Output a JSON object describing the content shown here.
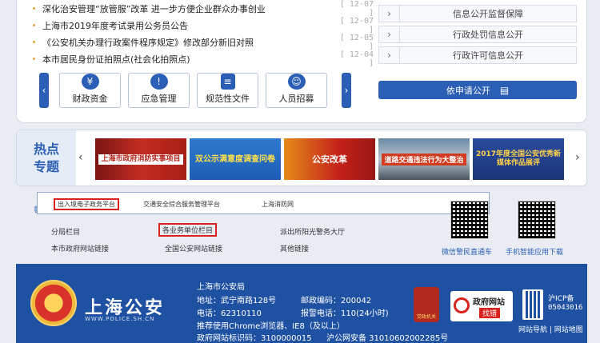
{
  "news": [
    {
      "title": "深化治安管理“放管服”改革 进一步方便企业群众办事创业",
      "date": "[ 12-07 ]"
    },
    {
      "title": "上海市2019年度考试录用公务员公告",
      "date": "[ 12-07 ]"
    },
    {
      "title": "《公安机关办理行政案件程序规定》修改部分新旧对照",
      "date": "[ 12-05 ]"
    },
    {
      "title": "本市居民身份证拍照点(社会化拍照点)",
      "date": "[ 12-04 ]"
    }
  ],
  "categories": [
    {
      "label": "财政资金",
      "icon": "¥"
    },
    {
      "label": "应急管理",
      "icon": "!"
    },
    {
      "label": "规范性文件",
      "icon": "≡"
    },
    {
      "label": "人员招募",
      "icon": "☺"
    }
  ],
  "info_public": [
    {
      "label": "信息公开监督保障"
    },
    {
      "label": "行政处罚信息公开"
    },
    {
      "label": "行政许可信息公开"
    }
  ],
  "apply_label": "依申请公开",
  "hot": {
    "label_line1": "热点",
    "label_line2": "专题",
    "banners": [
      "上海市政府消防实事项目",
      "双公示满意度调查问卷",
      "公安改革",
      "道路交通违法行为大整治",
      "2017年度全国公安优秀新媒体作品展评"
    ]
  },
  "link_tabs": [
    "出入境电子政务平台",
    "交通安全综合服务管理平台",
    "上海消防网"
  ],
  "links": {
    "branch": "分局栏目",
    "units": "各业务单位栏目",
    "station": "派出所阳光警务大厅",
    "city_gov": "本市政府网站链接",
    "national": "全国公安网站链接",
    "other": "其他链接"
  },
  "qr": {
    "wechat": "微信警民直通车",
    "app": "手机智能应用下载"
  },
  "footer": {
    "logo_cn": "上海公安",
    "logo_en": "WWW.POLICE.SH.CN",
    "org": "上海市公安局",
    "address": "地址：武宁南路128号",
    "postcode": "邮政编码：200042",
    "phone": "电话：62310110",
    "alarm": "报警电话：110(24小时)",
    "browser": "推荐使用Chrome浏览器、IE8（及以上）",
    "gov_code": "政府网站标识码：3100000015",
    "security_record": "沪公网安备 31010602002285号",
    "find_error_1": "政府网站",
    "find_error_2": "找错",
    "badge_text": "党政机关",
    "icp_1": "沪ICP备",
    "icp_2": "05043016",
    "sitemap": "网站导航 | 网站地图"
  }
}
